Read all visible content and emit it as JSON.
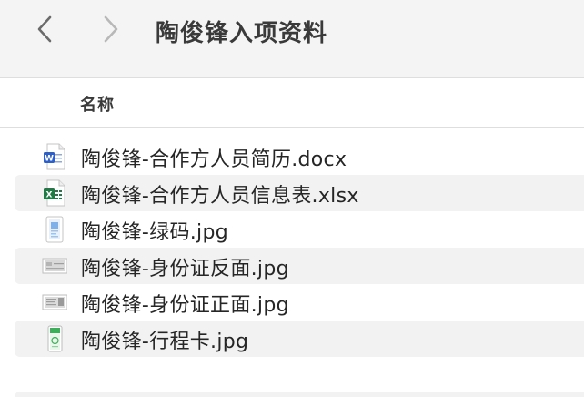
{
  "window": {
    "title": "陶俊锋入项资料"
  },
  "toolbar": {
    "back_icon": "chevron-left-icon",
    "forward_icon": "chevron-right-icon"
  },
  "columns": {
    "name": "名称"
  },
  "files": [
    {
      "name": "陶俊锋-合作方人员简历.docx",
      "icon": "word-document-icon"
    },
    {
      "name": "陶俊锋-合作方人员信息表.xlsx",
      "icon": "excel-spreadsheet-icon"
    },
    {
      "name": "陶俊锋-绿码.jpg",
      "icon": "image-file-icon"
    },
    {
      "name": "陶俊锋-身份证反面.jpg",
      "icon": "id-card-image-icon"
    },
    {
      "name": "陶俊锋-身份证正面.jpg",
      "icon": "id-card-image-icon"
    },
    {
      "name": "陶俊锋-行程卡.jpg",
      "icon": "phone-screenshot-icon"
    }
  ],
  "colors": {
    "word_blue": "#2b5fc9",
    "excel_green": "#1f7a45",
    "row_alt": "#f2f2f2",
    "toolbar_bg": "#f4f4f4"
  }
}
